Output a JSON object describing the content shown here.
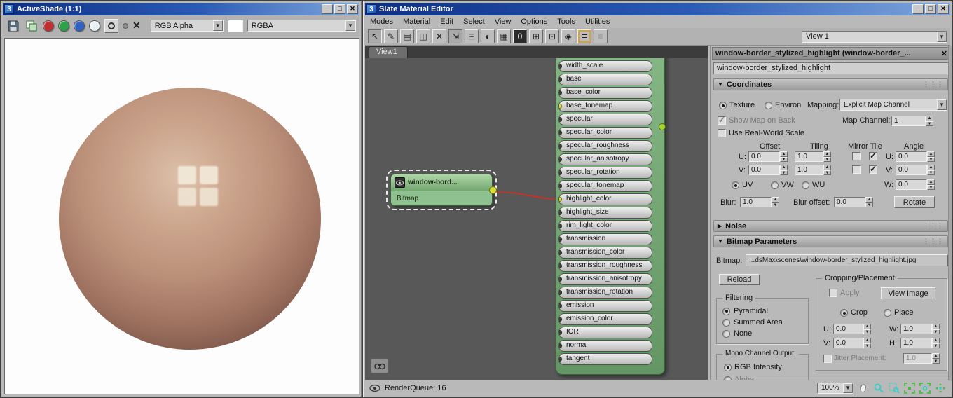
{
  "activeshade": {
    "title": "ActiveShade (1:1)",
    "channel_dropdown": "RGB Alpha",
    "format_dropdown": "RGBA"
  },
  "slate": {
    "title": "Slate Material Editor",
    "menu": [
      "Modes",
      "Material",
      "Edit",
      "Select",
      "View",
      "Options",
      "Tools",
      "Utilities"
    ],
    "toolbar_icons": [
      {
        "name": "select-tool",
        "glyph": "↖",
        "state": "pressed"
      },
      {
        "name": "pick-material-from-object",
        "glyph": "✎",
        "state": ""
      },
      {
        "name": "put-material-to-library",
        "glyph": "▤",
        "state": ""
      },
      {
        "name": "put-material-to-scene",
        "glyph": "◫",
        "state": ""
      },
      {
        "name": "delete-selected",
        "glyph": "✕",
        "state": ""
      },
      {
        "name": "move-children",
        "glyph": "⇲",
        "state": "pressed"
      },
      {
        "name": "hide-unused-nodeslots",
        "glyph": "⊟",
        "state": ""
      },
      {
        "name": "show-shaded-material",
        "glyph": "◐",
        "state": ""
      },
      {
        "name": "show-background",
        "glyph": "▦",
        "state": ""
      },
      {
        "name": "show-realistic-maps",
        "glyph": "0",
        "state": "dark"
      },
      {
        "name": "layout-all",
        "glyph": "⊞",
        "state": ""
      },
      {
        "name": "layout-children",
        "glyph": "⊡",
        "state": ""
      },
      {
        "name": "material-id-channel",
        "glyph": "◈",
        "state": ""
      },
      {
        "name": "show-grid",
        "glyph": "≣",
        "state": "active"
      },
      {
        "name": "select-by-material",
        "glyph": "≡",
        "state": "disabled"
      }
    ],
    "view_selector": "View 1",
    "tab": "View1",
    "status": "RenderQueue: 16",
    "zoom": "100%"
  },
  "graph": {
    "params": [
      "width_scale",
      "base",
      "base_color",
      "base_tonemap",
      "specular",
      "specular_color",
      "specular_roughness",
      "specular_anisotropy",
      "specular_rotation",
      "specular_tonemap",
      "highlight_color",
      "highlight_size",
      "rim_light_color",
      "transmission",
      "transmission_color",
      "transmission_roughness",
      "transmission_anisotropy",
      "transmission_rotation",
      "emission",
      "emission_color",
      "IOR",
      "normal",
      "tangent"
    ],
    "connected_params": [
      "base_tonemap",
      "highlight_color"
    ],
    "bitmap_node": {
      "title": "window-bord...",
      "type": "Bitmap"
    }
  },
  "panel": {
    "header": "window-border_stylized_highlight (window-border_...",
    "name": "window-border_stylized_highlight",
    "coordinates": {
      "title": "Coordinates",
      "texture": "Texture",
      "environ": "Environ",
      "mapping_label": "Mapping:",
      "mapping_value": "Explicit Map Channel",
      "show_map_on_back": "Show Map on Back",
      "map_channel_label": "Map Channel:",
      "map_channel": "1",
      "use_real_world": "Use Real-World Scale",
      "col_offset": "Offset",
      "col_tiling": "Tiling",
      "col_mirror_tile": "Mirror Tile",
      "col_angle": "Angle",
      "u_label": "U:",
      "v_label": "V:",
      "w_label": "W:",
      "u_offset": "0.0",
      "u_tiling": "1.0",
      "u_angle": "0.0",
      "v_offset": "0.0",
      "v_tiling": "1.0",
      "v_angle": "0.0",
      "w_angle": "0.0",
      "uv": "UV",
      "vw": "VW",
      "wu": "WU",
      "blur_label": "Blur:",
      "blur": "1.0",
      "blur_offset_label": "Blur offset:",
      "blur_offset": "0.0",
      "rotate": "Rotate"
    },
    "noise_title": "Noise",
    "bitmap_params": {
      "title": "Bitmap Parameters",
      "bitmap_label": "Bitmap:",
      "bitmap_path": "...dsMax\\scenes\\window-border_stylized_highlight.jpg",
      "reload": "Reload",
      "cropping_title": "Cropping/Placement",
      "apply": "Apply",
      "view_image": "View Image",
      "crop": "Crop",
      "place": "Place",
      "crop_u_label": "U:",
      "crop_u": "0.0",
      "crop_w_label": "W:",
      "crop_w": "1.0",
      "crop_v_label": "V:",
      "crop_v": "0.0",
      "crop_h_label": "H:",
      "crop_h": "1.0",
      "jitter_label": "Jitter Placement:",
      "jitter": "1.0",
      "filtering_title": "Filtering",
      "filter_options": [
        "Pyramidal",
        "Summed Area",
        "None"
      ],
      "mono_title": "Mono Channel Output:",
      "mono_rgb": "RGB Intensity",
      "mono_alpha": "Alpha"
    }
  }
}
